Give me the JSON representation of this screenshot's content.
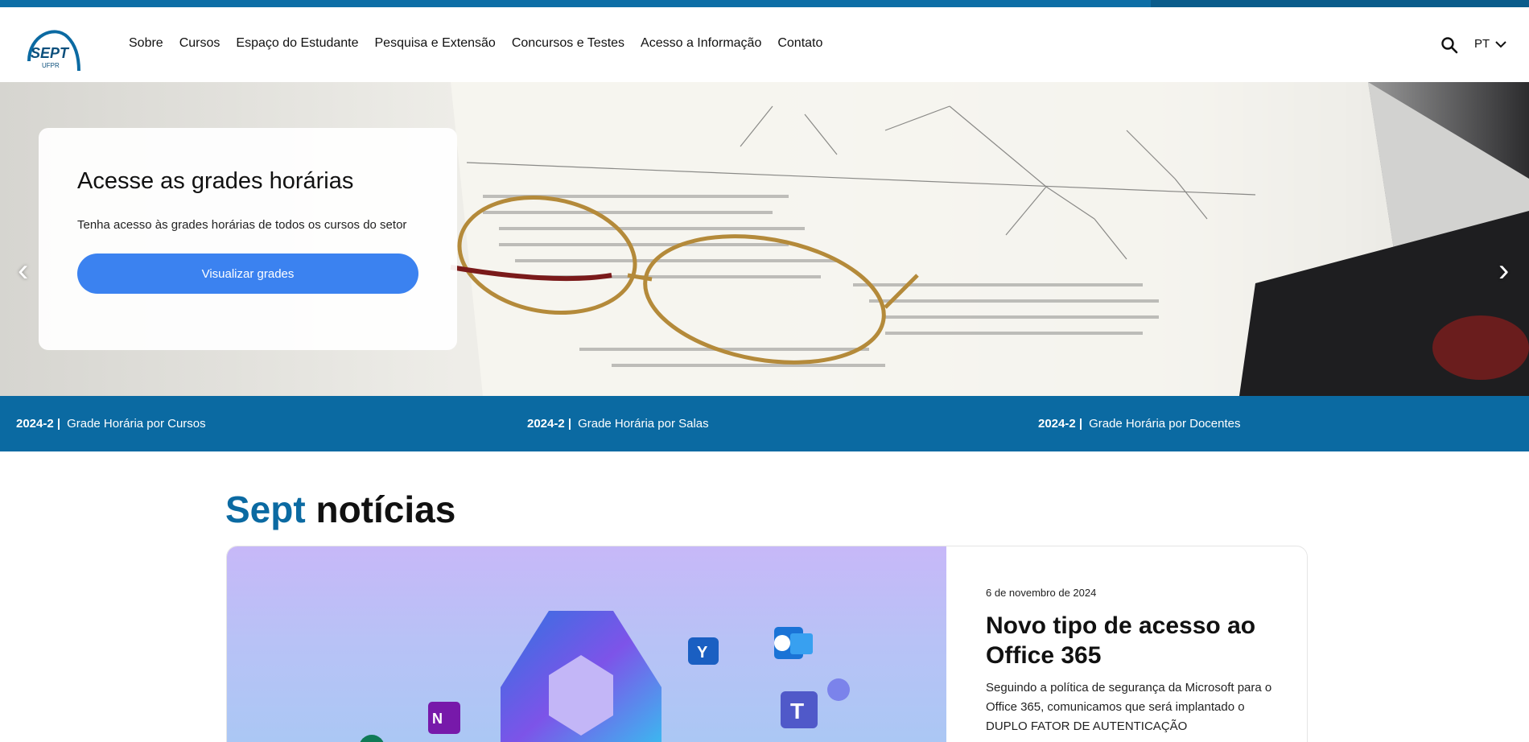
{
  "colors": {
    "brand": "#0b6aa2",
    "button": "#3b82f0",
    "topbar": "#0d6ea6"
  },
  "logo": {
    "text": "SEPT",
    "sub": "UFPR"
  },
  "nav": {
    "items": [
      {
        "label": "Sobre"
      },
      {
        "label": "Cursos"
      },
      {
        "label": "Espaço do Estudante"
      },
      {
        "label": "Pesquisa e Extensão"
      },
      {
        "label": "Concursos e Testes"
      },
      {
        "label": "Acesso a Informação"
      },
      {
        "label": "Contato"
      }
    ],
    "search_icon": "search-icon",
    "language": "PT"
  },
  "hero": {
    "title": "Acesse as grades horárias",
    "subtitle": "Tenha acesso às grades horárias de todos os cursos do setor",
    "button": "Visualizar grades",
    "prev_icon": "‹",
    "next_icon": "›"
  },
  "schedule_bar": [
    {
      "term": "2024-2 |",
      "label": "Grade Horária por Cursos"
    },
    {
      "term": "2024-2 |",
      "label": "Grade Horária por Salas"
    },
    {
      "term": "2024-2 |",
      "label": "Grade Horária por Docentes"
    }
  ],
  "news": {
    "heading_brand": "Sept",
    "heading_rest": "notícias",
    "article": {
      "date": "6 de novembro de 2024",
      "title": "Novo tipo de acesso ao Office 365",
      "body": "Seguindo a política de segurança da Microsoft para o Office 365, comunicamos que será implantado o DUPLO FATOR DE AUTENTICAÇÃO"
    }
  }
}
